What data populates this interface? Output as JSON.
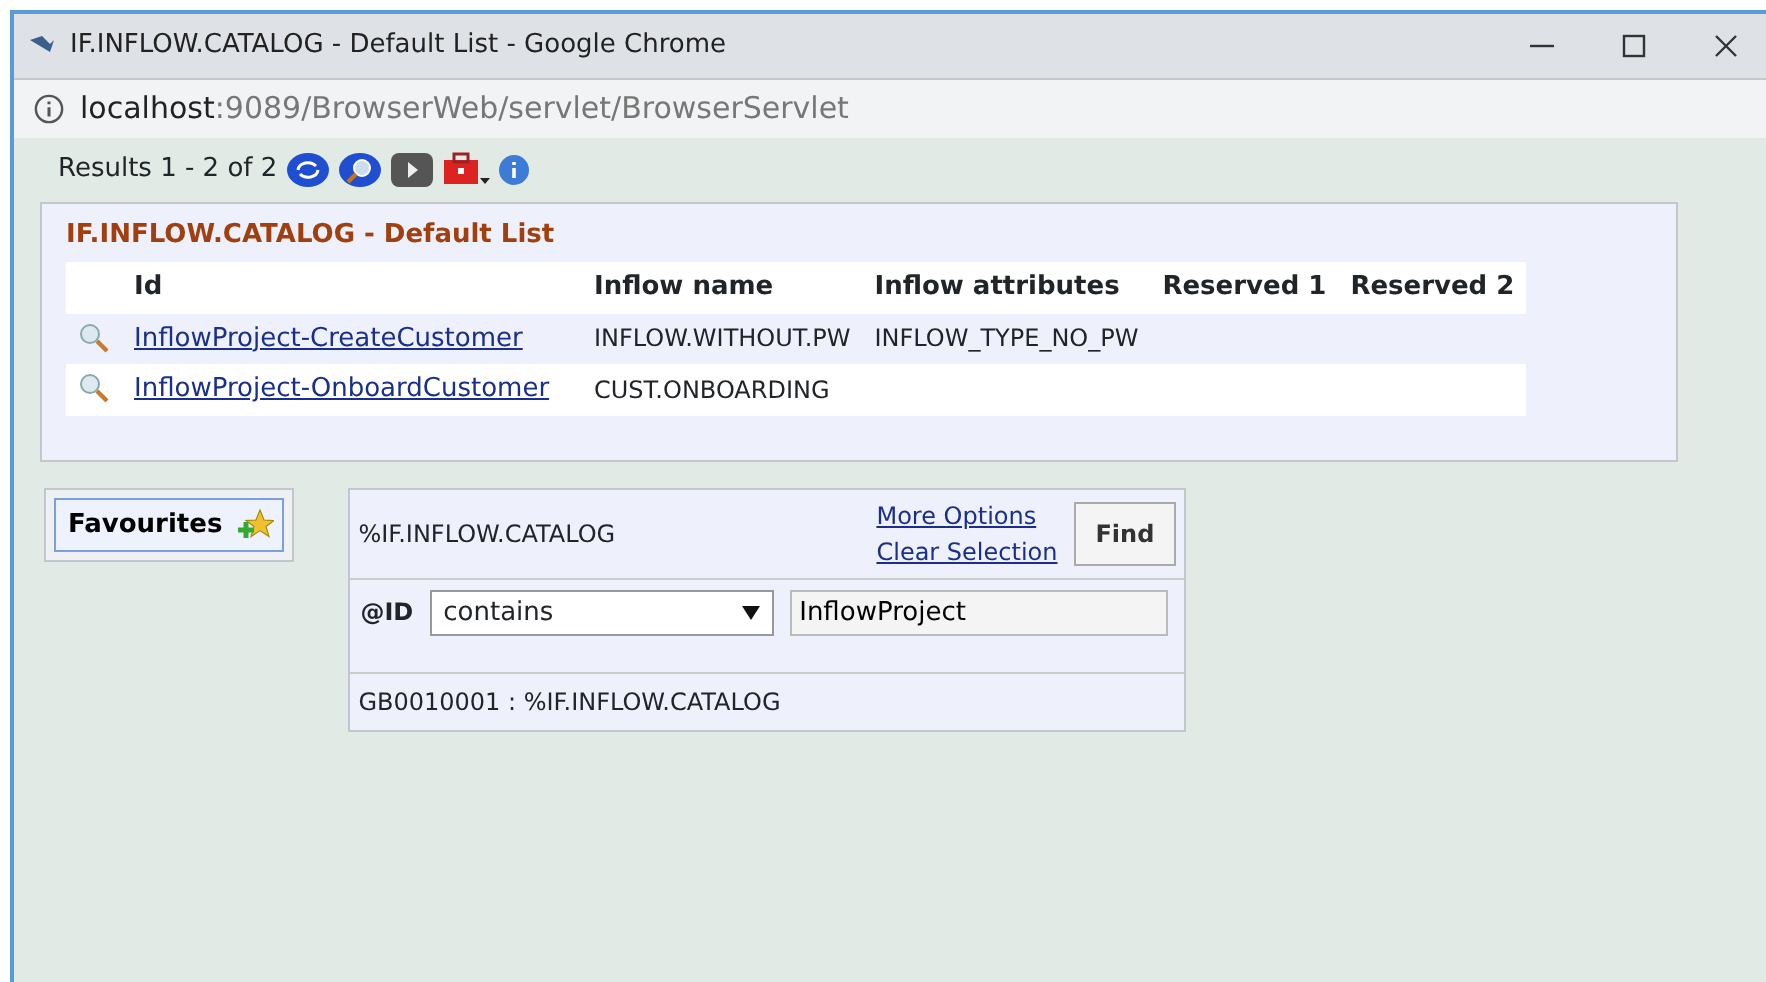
{
  "window": {
    "title": "IF.INFLOW.CATALOG - Default List - Google Chrome"
  },
  "address_bar": {
    "host": "localhost",
    "path": ":9089/BrowserWeb/servlet/BrowserServlet"
  },
  "toolbar": {
    "results": "Results 1 - 2 of 2"
  },
  "list": {
    "title": "IF.INFLOW.CATALOG - Default List",
    "columns": [
      "Id",
      "Inflow name",
      "Inflow attributes",
      "Reserved 1",
      "Reserved 2"
    ],
    "rows": [
      {
        "id": "InflowProject-CreateCustomer",
        "inflow_name": "INFLOW.WITHOUT.PW",
        "inflow_attributes": "INFLOW_TYPE_NO_PW"
      },
      {
        "id": "InflowProject-OnboardCustomer",
        "inflow_name": "CUST.ONBOARDING",
        "inflow_attributes": ""
      }
    ]
  },
  "favourites": {
    "label": "Favourites"
  },
  "search": {
    "name": "%IF.INFLOW.CATALOG",
    "links": [
      "More Options",
      "Clear Selection"
    ],
    "find": "Find",
    "field_label": "@ID",
    "operator": "contains",
    "value": "InflowProject",
    "footer": "GB0010001 : %IF.INFLOW.CATALOG"
  }
}
